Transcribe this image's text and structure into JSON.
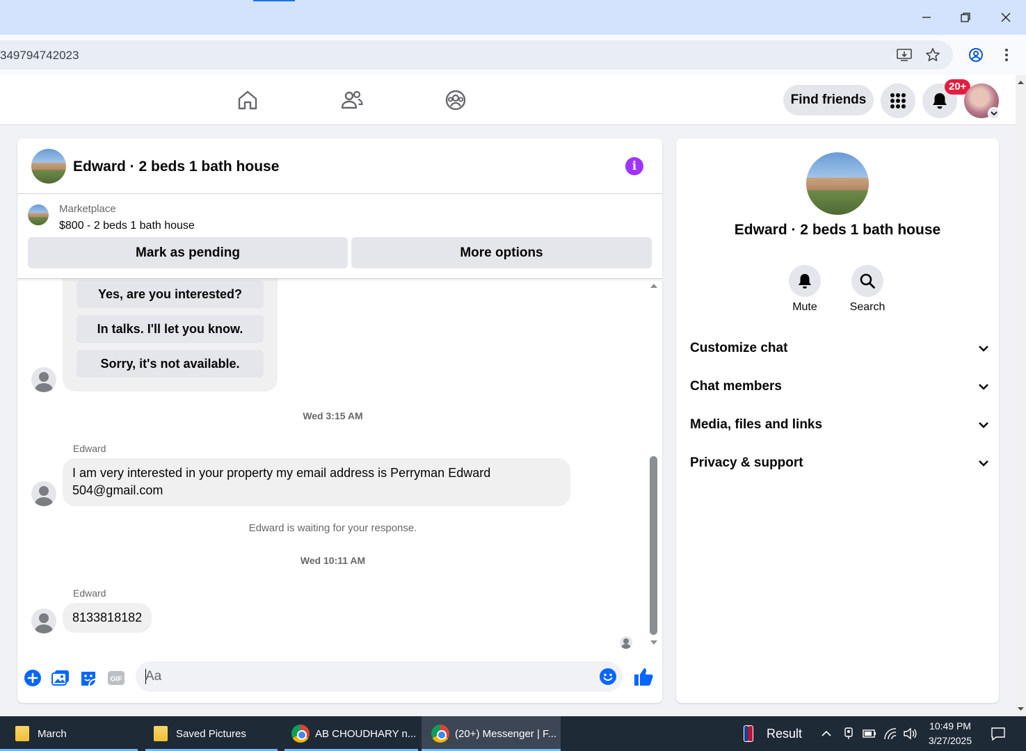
{
  "browser": {
    "url": "349794742023"
  },
  "header": {
    "find_friends": "Find friends",
    "notification_badge": "20+"
  },
  "chat": {
    "title": "Edward · 2 beds 1 bath house",
    "marketplace_label": "Marketplace",
    "listing": "$800 - 2 beds 1 bath house",
    "mark_pending": "Mark as pending",
    "more_options": "More options",
    "quick_replies": [
      "Yes, are you interested?",
      "In talks. I'll let you know.",
      "Sorry, it's not available."
    ],
    "messages": [
      {
        "timestamp": "Wed 3:15 AM",
        "sender": "Edward",
        "text_line1": "I am very interested in your property my email address is Perryman Edward",
        "text_line2": "504@gmail.com"
      },
      {
        "status": "Edward is waiting for your response.",
        "timestamp": "Wed 10:11 AM",
        "sender": "Edward",
        "text": "8133818182"
      }
    ],
    "composer_placeholder": "Aa"
  },
  "info_panel": {
    "title": "Edward · 2 beds 1 bath house",
    "mute": "Mute",
    "search": "Search",
    "sections": [
      "Customize chat",
      "Chat members",
      "Media, files and links",
      "Privacy & support"
    ]
  },
  "taskbar": {
    "items": [
      "March",
      "Saved Pictures",
      "AB CHOUDHARY n...",
      "(20+) Messenger | F..."
    ],
    "result": "Result",
    "time": "10:49 PM",
    "date": "3/27/2025"
  },
  "colors": {
    "accent": "#0866ff",
    "info_purple": "#a033ff",
    "badge_red": "#e41e3f"
  }
}
